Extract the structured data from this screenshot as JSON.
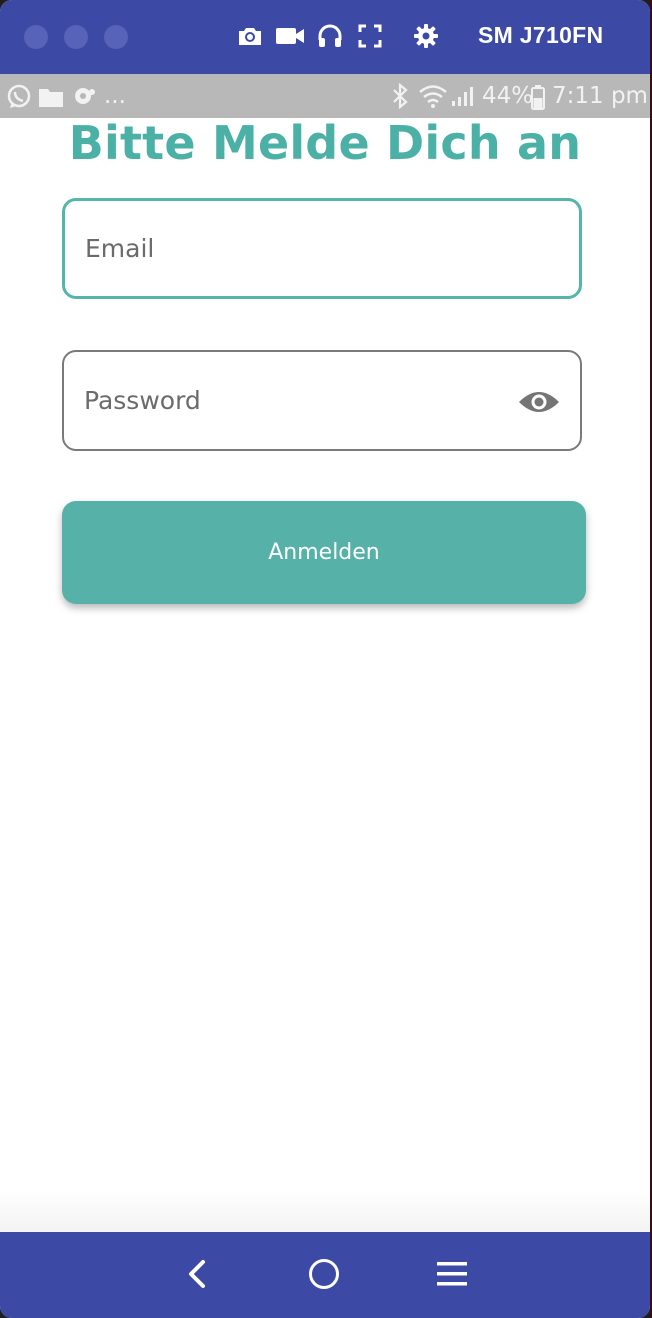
{
  "emulator": {
    "device_name": "SM J710FN",
    "window_controls": [
      "close",
      "minimize",
      "maximize"
    ],
    "toolbar_icons": [
      "camera-icon",
      "video-icon",
      "headphones-icon",
      "fullscreen-icon",
      "gear-icon"
    ]
  },
  "status_bar": {
    "notifications_more": "...",
    "battery": "44%",
    "time": "7:11 pm"
  },
  "login": {
    "title": "Bitte Melde Dich an",
    "email_placeholder": "Email",
    "password_placeholder": "Password",
    "submit_label": "Anmelden"
  },
  "colors": {
    "accent": "#4bb0a6",
    "button": "#56b1a8",
    "toolbar": "#3c4aa6",
    "status_bar": "#b8b8b8"
  },
  "nav_bar": {
    "icons": [
      "back-icon",
      "home-icon",
      "recents-icon"
    ]
  }
}
